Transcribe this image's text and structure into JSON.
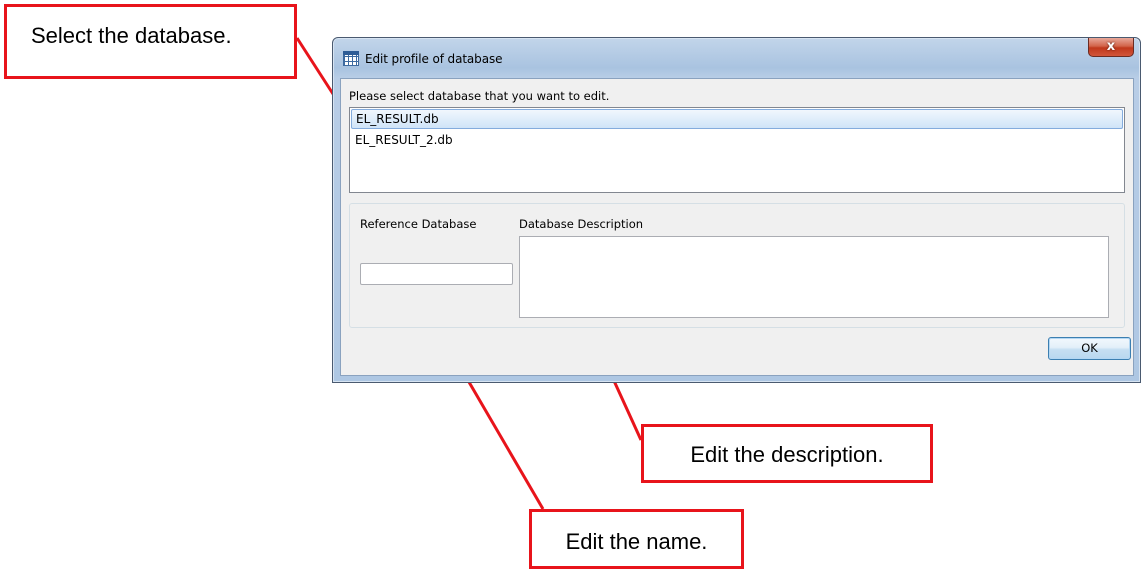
{
  "window": {
    "title": "Edit profile of database",
    "close_label": "x"
  },
  "prompt": "Please select database that you want to edit.",
  "databases": [
    {
      "name": "EL_RESULT.db",
      "selected": true
    },
    {
      "name": "EL_RESULT_2.db",
      "selected": false
    }
  ],
  "reference": {
    "label": "Reference Database",
    "value": ""
  },
  "description": {
    "label": "Database Description",
    "value": ""
  },
  "ok_label": "OK",
  "callouts": {
    "select": "Select the database.",
    "description": "Edit the description.",
    "name": "Edit the name."
  },
  "colors": {
    "callout_border": "#e8141b",
    "leader_line": "#e8141b",
    "selection_bg": "#cfe4f8",
    "window_frame": "#aec7e3"
  }
}
